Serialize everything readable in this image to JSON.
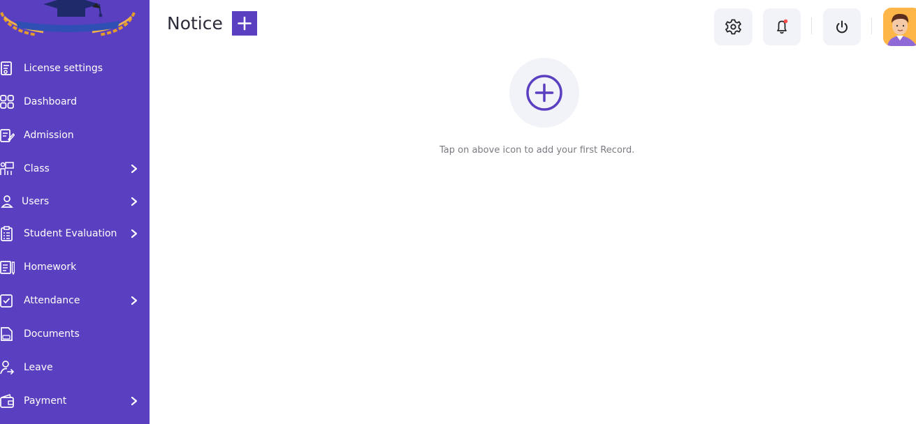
{
  "page": {
    "title": "Notice"
  },
  "sidebar": {
    "items": [
      {
        "label": "License settings",
        "icon": "license-icon",
        "has_submenu": false
      },
      {
        "label": "Dashboard",
        "icon": "dashboard-grid-icon",
        "has_submenu": false
      },
      {
        "label": "Admission",
        "icon": "admission-form-icon",
        "has_submenu": false
      },
      {
        "label": "Class",
        "icon": "class-presentation-icon",
        "has_submenu": true
      },
      {
        "label": "Users",
        "icon": "user-icon",
        "has_submenu": true
      },
      {
        "label": "Student Evaluation",
        "icon": "evaluation-checklist-icon",
        "has_submenu": true
      },
      {
        "label": "Homework",
        "icon": "homework-book-icon",
        "has_submenu": false
      },
      {
        "label": "Attendance",
        "icon": "attendance-check-icon",
        "has_submenu": true
      },
      {
        "label": "Documents",
        "icon": "document-icon",
        "has_submenu": false
      },
      {
        "label": "Leave",
        "icon": "leave-user-icon",
        "has_submenu": false
      },
      {
        "label": "Payment",
        "icon": "wallet-icon",
        "has_submenu": true
      }
    ]
  },
  "header": {
    "settings_icon": "gear-icon",
    "notifications_icon": "bell-icon",
    "notification_dot": true,
    "power_icon": "power-icon",
    "avatar_icon": "user-avatar"
  },
  "empty_state": {
    "icon": "plus-circle-icon",
    "message": "Tap on above icon to add your first Record."
  },
  "colors": {
    "sidebar_bg": "#5a3fc0",
    "accent": "#5a3fc0",
    "icon_button_bg": "#f1f3f8",
    "notification_dot": "#ff4d4d",
    "avatar_bg": "#ffb648"
  }
}
